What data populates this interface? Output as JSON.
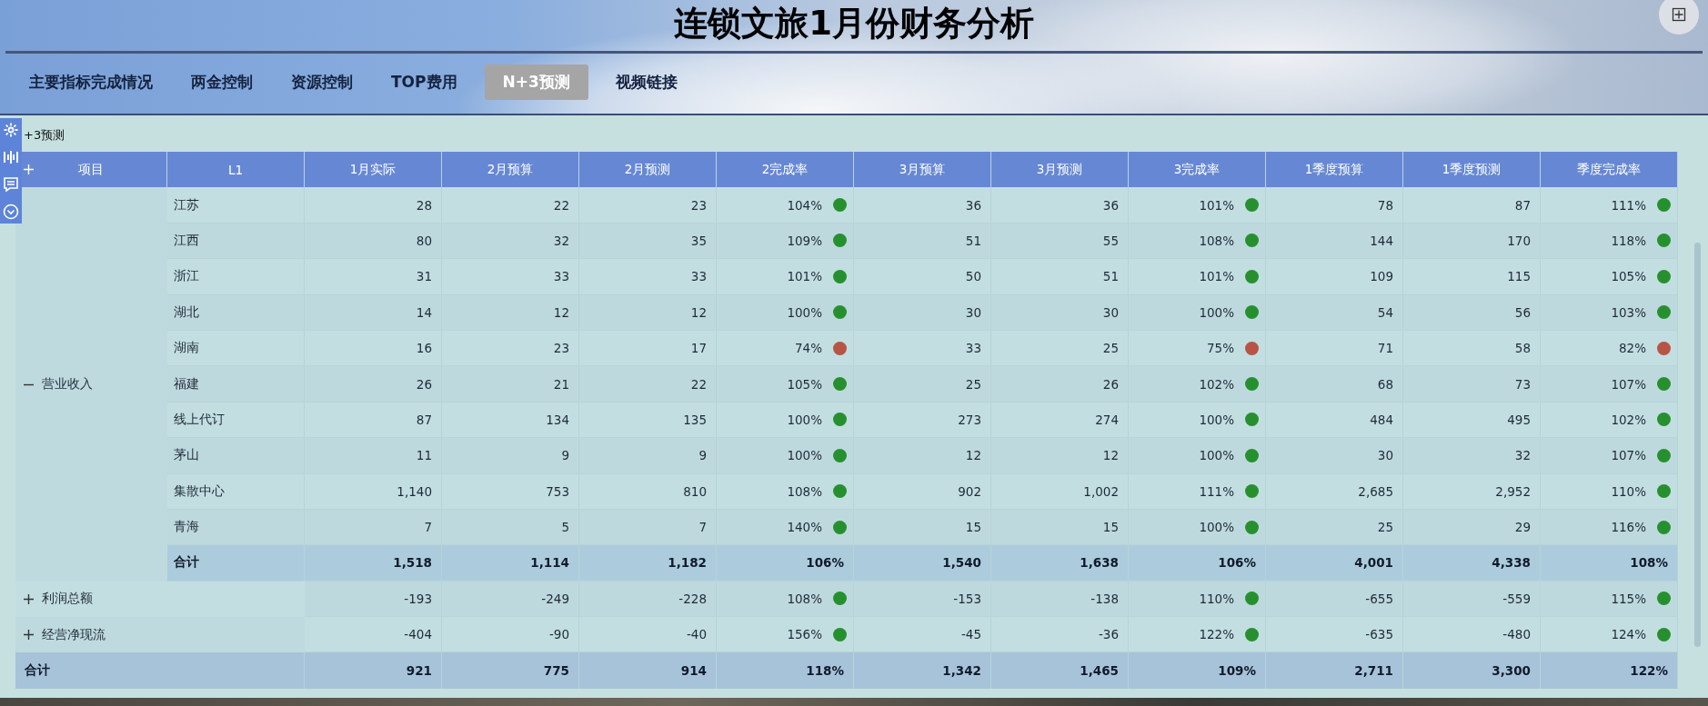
{
  "title": "连锁文旅1月份财务分析",
  "tabs": [
    {
      "label": "主要指标完成情况",
      "selected": false
    },
    {
      "label": "两金控制",
      "selected": false
    },
    {
      "label": "资源控制",
      "selected": false
    },
    {
      "label": "TOP费用",
      "selected": false
    },
    {
      "label": "N+3预测",
      "selected": true
    },
    {
      "label": "视频链接",
      "selected": false
    }
  ],
  "panel_title": "+3预测",
  "table": {
    "columns": [
      "项目",
      "L1",
      "1月实际",
      "2月预算",
      "2月预测",
      "2完成率",
      "3月预算",
      "3月预测",
      "3完成率",
      "1季度预算",
      "1季度预测",
      "季度完成率"
    ],
    "groups": [
      {
        "label": "营业收入",
        "expanded": true,
        "rows": [
          {
            "l1": "江苏",
            "values": [
              "28",
              "22",
              "23",
              {
                "text": "104%",
                "color": "#26902f"
              },
              "36",
              "36",
              {
                "text": "101%",
                "color": "#26902f"
              },
              "78",
              "87",
              {
                "text": "111%",
                "color": "#26902f"
              }
            ]
          },
          {
            "l1": "江西",
            "values": [
              "80",
              "32",
              "35",
              {
                "text": "109%",
                "color": "#26902f"
              },
              "51",
              "55",
              {
                "text": "108%",
                "color": "#26902f"
              },
              "144",
              "170",
              {
                "text": "118%",
                "color": "#26902f"
              }
            ]
          },
          {
            "l1": "浙江",
            "values": [
              "31",
              "33",
              "33",
              {
                "text": "101%",
                "color": "#26902f"
              },
              "50",
              "51",
              {
                "text": "101%",
                "color": "#26902f"
              },
              "109",
              "115",
              {
                "text": "105%",
                "color": "#26902f"
              }
            ]
          },
          {
            "l1": "湖北",
            "values": [
              "14",
              "12",
              "12",
              {
                "text": "100%",
                "color": "#26902f"
              },
              "30",
              "30",
              {
                "text": "100%",
                "color": "#26902f"
              },
              "54",
              "56",
              {
                "text": "103%",
                "color": "#26902f"
              }
            ]
          },
          {
            "l1": "湖南",
            "values": [
              "16",
              "23",
              "17",
              {
                "text": "74%",
                "color": "#b85445"
              },
              "33",
              "25",
              {
                "text": "75%",
                "color": "#b85445"
              },
              "71",
              "58",
              {
                "text": "82%",
                "color": "#b85445"
              }
            ]
          },
          {
            "l1": "福建",
            "values": [
              "26",
              "21",
              "22",
              {
                "text": "105%",
                "color": "#26902f"
              },
              "25",
              "26",
              {
                "text": "102%",
                "color": "#26902f"
              },
              "68",
              "73",
              {
                "text": "107%",
                "color": "#26902f"
              }
            ]
          },
          {
            "l1": "线上代订",
            "values": [
              "87",
              "134",
              "135",
              {
                "text": "100%",
                "color": "#26902f"
              },
              "273",
              "274",
              {
                "text": "100%",
                "color": "#26902f"
              },
              "484",
              "495",
              {
                "text": "102%",
                "color": "#26902f"
              }
            ]
          },
          {
            "l1": "茅山",
            "values": [
              "11",
              "9",
              "9",
              {
                "text": "100%",
                "color": "#26902f"
              },
              "12",
              "12",
              {
                "text": "100%",
                "color": "#26902f"
              },
              "30",
              "32",
              {
                "text": "107%",
                "color": "#26902f"
              }
            ]
          },
          {
            "l1": "集散中心",
            "values": [
              "1,140",
              "753",
              "810",
              {
                "text": "108%",
                "color": "#26902f"
              },
              "902",
              "1,002",
              {
                "text": "111%",
                "color": "#26902f"
              },
              "2,685",
              "2,952",
              {
                "text": "110%",
                "color": "#26902f"
              }
            ]
          },
          {
            "l1": "青海",
            "values": [
              "7",
              "5",
              "7",
              {
                "text": "140%",
                "color": "#26902f"
              },
              "15",
              "15",
              {
                "text": "100%",
                "color": "#26902f"
              },
              "25",
              "29",
              {
                "text": "116%",
                "color": "#26902f"
              }
            ]
          }
        ],
        "subtotal": {
          "label": "合计",
          "values": [
            "1,518",
            "1,114",
            "1,182",
            "106%",
            "1,540",
            "1,638",
            "106%",
            "4,001",
            "4,338",
            "108%"
          ]
        }
      },
      {
        "label": "利润总额",
        "expanded": false,
        "values": [
          "-193",
          "-249",
          "-228",
          {
            "text": "108%",
            "color": "#26902f"
          },
          "-153",
          "-138",
          {
            "text": "110%",
            "color": "#26902f"
          },
          "-655",
          "-559",
          {
            "text": "115%",
            "color": "#26902f"
          }
        ]
      },
      {
        "label": "经营净现流",
        "expanded": false,
        "values": [
          "-404",
          "-90",
          "-40",
          {
            "text": "156%",
            "color": "#26902f"
          },
          "-45",
          "-36",
          {
            "text": "122%",
            "color": "#26902f"
          },
          "-635",
          "-480",
          {
            "text": "124%",
            "color": "#26902f"
          }
        ]
      }
    ],
    "grand_total": {
      "label": "合计",
      "values": [
        "921",
        "775",
        "914",
        "118%",
        "1,342",
        "1,465",
        "109%",
        "2,711",
        "3,300",
        "122%"
      ]
    }
  }
}
